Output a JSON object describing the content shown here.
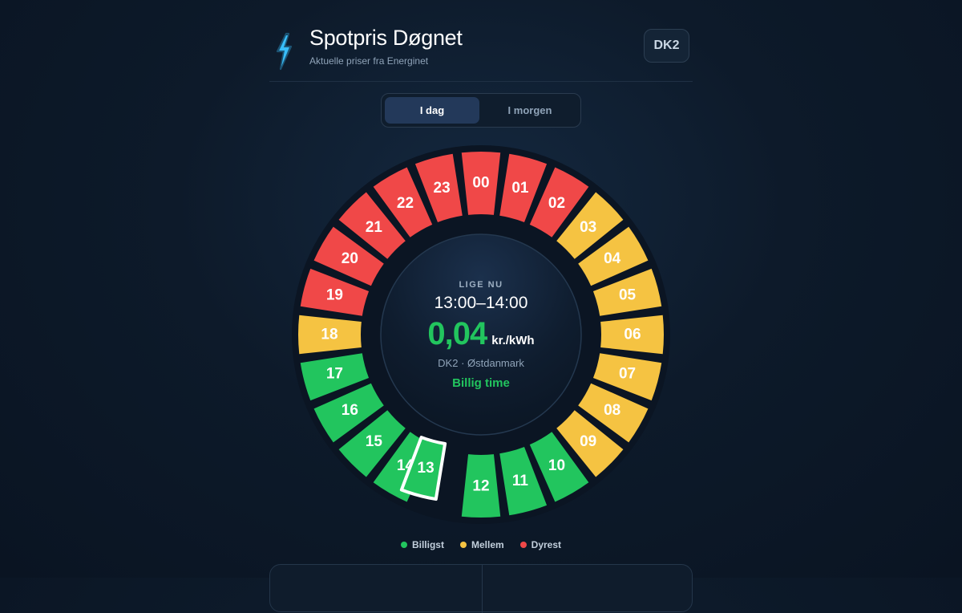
{
  "header": {
    "title": "Spotpris Døgnet",
    "subtitle": "Aktuelle priser fra Energinet",
    "region_button": "DK2"
  },
  "tabs": [
    {
      "label": "I dag",
      "active": true
    },
    {
      "label": "I morgen",
      "active": false
    }
  ],
  "colors": {
    "cheap": "#22c55e",
    "medium": "#f5c342",
    "expensive": "#f04848",
    "selected_outline": "#ffffff"
  },
  "hours": [
    {
      "label": "00",
      "level": "expensive"
    },
    {
      "label": "01",
      "level": "expensive"
    },
    {
      "label": "02",
      "level": "expensive"
    },
    {
      "label": "03",
      "level": "medium"
    },
    {
      "label": "04",
      "level": "medium"
    },
    {
      "label": "05",
      "level": "medium"
    },
    {
      "label": "06",
      "level": "medium"
    },
    {
      "label": "07",
      "level": "medium"
    },
    {
      "label": "08",
      "level": "medium"
    },
    {
      "label": "09",
      "level": "medium"
    },
    {
      "label": "10",
      "level": "cheap"
    },
    {
      "label": "11",
      "level": "cheap"
    },
    {
      "label": "12",
      "level": "cheap"
    },
    {
      "label": "13",
      "level": "cheap",
      "selected": true
    },
    {
      "label": "14",
      "level": "cheap"
    },
    {
      "label": "15",
      "level": "cheap"
    },
    {
      "label": "16",
      "level": "cheap"
    },
    {
      "label": "17",
      "level": "cheap"
    },
    {
      "label": "18",
      "level": "medium"
    },
    {
      "label": "19",
      "level": "expensive"
    },
    {
      "label": "20",
      "level": "expensive"
    },
    {
      "label": "21",
      "level": "expensive"
    },
    {
      "label": "22",
      "level": "expensive"
    },
    {
      "label": "23",
      "level": "expensive"
    }
  ],
  "current": {
    "label": "LIGE NU",
    "time_range": "13:00–14:00",
    "price": "0,04",
    "unit": "kr./kWh",
    "region": "DK2 · Østdanmark",
    "status": "Billig time"
  },
  "legend": [
    {
      "label": "Billigst",
      "level": "cheap"
    },
    {
      "label": "Mellem",
      "level": "medium"
    },
    {
      "label": "Dyrest",
      "level": "expensive"
    }
  ]
}
